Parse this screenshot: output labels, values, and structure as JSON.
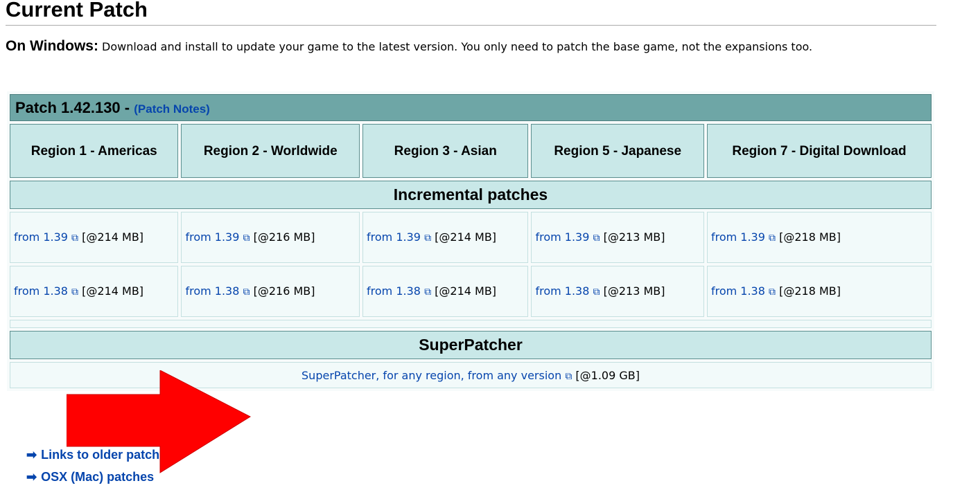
{
  "heading": "Current Patch",
  "intro": {
    "lead": "On Windows:",
    "text": " Download and install to update your game to the latest version. You only need to patch the base game, not the expansions too."
  },
  "patch": {
    "title": "Patch 1.42.130",
    "separator": " - ",
    "notes_link": "(Patch Notes)",
    "regions": [
      "Region 1 - Americas",
      "Region 2 - Worldwide",
      "Region 3 - Asian",
      "Region 5 - Japanese",
      "Region 7 - Digital Download"
    ],
    "incremental_label": "Incremental patches",
    "rows": [
      [
        {
          "link": "from 1.39",
          "size": "[@214 MB]"
        },
        {
          "link": "from 1.39",
          "size": "[@216 MB]"
        },
        {
          "link": "from 1.39",
          "size": "[@214 MB]"
        },
        {
          "link": "from 1.39",
          "size": "[@213 MB]"
        },
        {
          "link": "from 1.39",
          "size": "[@218 MB]"
        }
      ],
      [
        {
          "link": "from 1.38",
          "size": "[@214 MB]"
        },
        {
          "link": "from 1.38",
          "size": "[@216 MB]"
        },
        {
          "link": "from 1.38",
          "size": "[@214 MB]"
        },
        {
          "link": "from 1.38",
          "size": "[@213 MB]"
        },
        {
          "link": "from 1.38",
          "size": "[@218 MB]"
        }
      ]
    ],
    "superpatcher_label": "SuperPatcher",
    "superpatcher_link": "SuperPatcher, for any region, from any version",
    "superpatcher_size": "[@1.09 GB]"
  },
  "links": {
    "older": "Links to older patches",
    "osx": "OSX (Mac) patches"
  },
  "icons": {
    "external": "external-link-icon",
    "arrow": "right-arrow-icon"
  },
  "colors": {
    "title_bg": "#6ea6a6",
    "header_bg": "#c9e8e8",
    "link": "#0645ad",
    "annotation": "#ff0000"
  }
}
